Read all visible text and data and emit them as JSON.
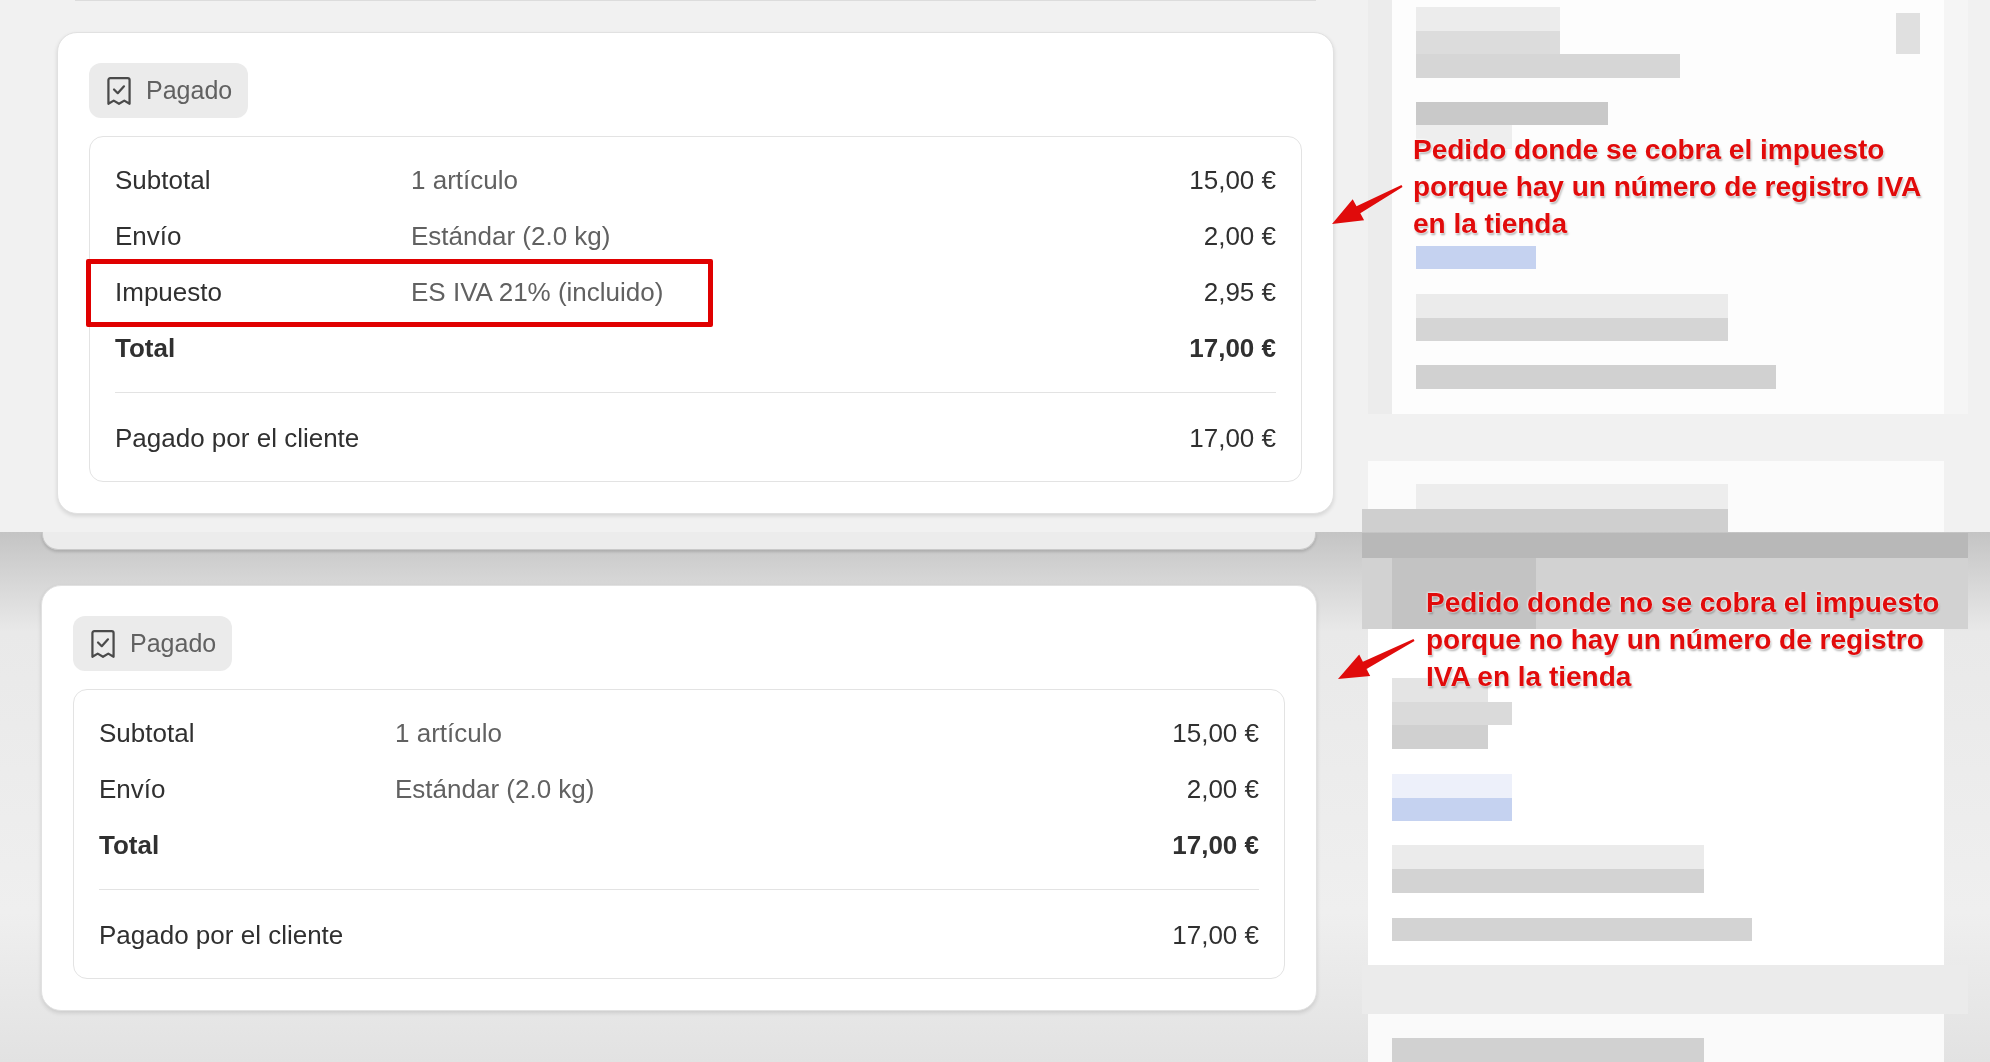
{
  "orders": [
    {
      "status_badge": {
        "label": "Pagado"
      },
      "rows": [
        {
          "kind": "line",
          "label": "Subtotal",
          "detail": "1 artículo",
          "amount": "15,00 €",
          "highlighted": false
        },
        {
          "kind": "line",
          "label": "Envío",
          "detail": "Estándar (2.0 kg)",
          "amount": "2,00 €",
          "highlighted": false
        },
        {
          "kind": "line",
          "label": "Impuesto",
          "detail": "ES IVA 21% (incluido)",
          "amount": "2,95 €",
          "highlighted": true
        },
        {
          "kind": "total",
          "label": "Total",
          "amount": "17,00 €",
          "highlighted": false
        }
      ],
      "paid_row": {
        "label": "Pagado por el cliente",
        "amount": "17,00 €"
      },
      "annotation": {
        "text": "Pedido donde se cobra el impuesto porque hay un número de registro IVA en la tienda"
      }
    },
    {
      "status_badge": {
        "label": "Pagado"
      },
      "rows": [
        {
          "kind": "line",
          "label": "Subtotal",
          "detail": "1 artículo",
          "amount": "15,00 €",
          "highlighted": false
        },
        {
          "kind": "line",
          "label": "Envío",
          "detail": "Estándar (2.0 kg)",
          "amount": "2,00 €",
          "highlighted": false
        },
        {
          "kind": "total",
          "label": "Total",
          "amount": "17,00 €",
          "highlighted": false
        }
      ],
      "paid_row": {
        "label": "Pagado por el cliente",
        "amount": "17,00 €"
      },
      "annotation": {
        "text": "Pedido donde no se cobra el impuesto porque no hay un número de registro IVA en la tienda"
      }
    }
  ]
}
